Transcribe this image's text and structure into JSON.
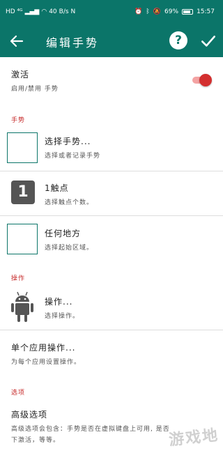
{
  "status_bar": {
    "left_text": "HD ⁴ᴳ",
    "speed_value": "40",
    "speed_unit": "B/s",
    "nfc": "N",
    "battery": "69%",
    "time": "15:57"
  },
  "toolbar": {
    "title": "编辑手势",
    "help_label": "?"
  },
  "enable": {
    "title": "激活",
    "subtitle": "启用/禁用 手势",
    "enabled": true
  },
  "sections": {
    "gesture": "手势",
    "action": "操作",
    "options": "选项"
  },
  "gesture_items": {
    "select": {
      "title": "选择手势...",
      "subtitle": "选择或者记录手势"
    },
    "touch": {
      "icon_text": "1",
      "title": "1触点",
      "subtitle": "选择触点个数。"
    },
    "anywhere": {
      "title": "任何地方",
      "subtitle": "选择起始区域。"
    }
  },
  "action_items": {
    "action": {
      "title": "操作...",
      "subtitle": "选择操作。"
    },
    "single_app": {
      "title": "单个应用操作...",
      "subtitle": "为每个应用设置操作。"
    }
  },
  "option_items": {
    "advanced": {
      "title": "高级选项",
      "subtitle_line1": "高级选项会包含：手势是否在虚拟键盘上可用, 是否",
      "subtitle_line2": "下激活，等等。"
    }
  },
  "watermark": "游戏地"
}
